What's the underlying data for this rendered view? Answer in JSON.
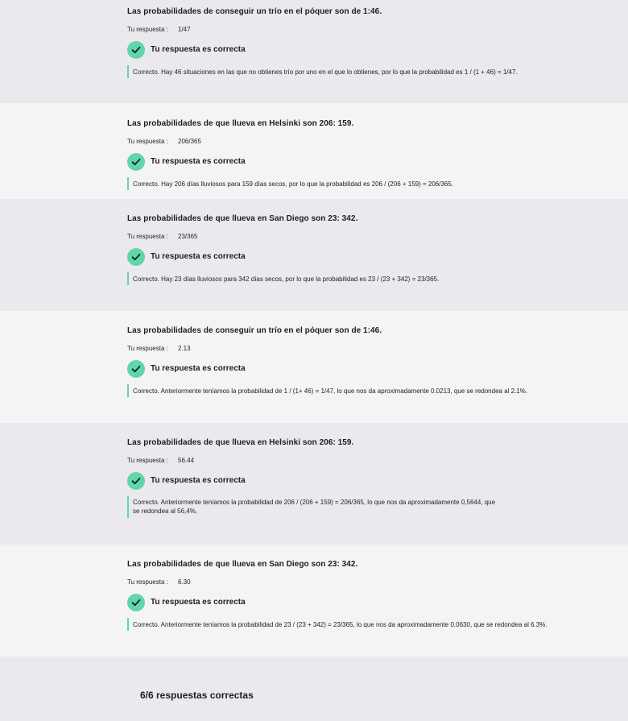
{
  "colors": {
    "accent": "#5fd6ab",
    "band_shade": "#ebe9ee",
    "band_light": "#f5f4f5"
  },
  "answer_label": "Tu respuesta :",
  "result_text": "Tu respuesta es correcta",
  "questions": [
    {
      "title": "Las probabilidades de conseguir un trío en el póquer son de 1:46.",
      "answer": "1/47",
      "explanation": "Correcto. Hay 46 situaciones en las que no obtienes trío por uno en el que lo obtienes, por lo que la probabilidad es 1 / (1 + 46) = 1/47."
    },
    {
      "title": "Las probabilidades de que llueva en Helsinki son 206: 159.",
      "answer": "206/365",
      "explanation": "Correcto. Hay 206 días lluviosos para 159 días secos, por lo que la probabilidad es 206 / (206 + 159) = 206/365."
    },
    {
      "title": "Las probabilidades de que llueva en San Diego son 23: 342.",
      "answer": "23/365",
      "explanation": "Correcto. Hay 23 días lluviosos para 342 días secos, por lo que la probabilidad es 23 / (23 + 342) = 23/365."
    },
    {
      "title": "Las probabilidades de conseguir un trío en el póquer son de 1:46.",
      "answer": "2.13",
      "explanation": "Correcto. Anteriormente teníamos la probabilidad de 1 / (1+ 46) = 1/47, lo que nos da aproximadamente 0.0213, que se redondea al 2.1%."
    },
    {
      "title": "Las probabilidades de que llueva en Helsinki son 206: 159.",
      "answer": "56.44",
      "explanation": "Correcto. Anteriormente teníamos la probabilidad de 206 / (206 + 159) = 206/365, lo que nos da aproximadamente 0,5644, que se redondea al 56,4%."
    },
    {
      "title": "Las probabilidades de que llueva en San Diego son 23: 342.",
      "answer": "6.30",
      "explanation": "Correcto. Anteriormente teníamos la probabilidad de 23 / (23 + 342) = 23/365, lo que nos da aproximadamente 0.0630, que se redondea al 6.3%."
    }
  ],
  "summary": "6/6 respuestas correctas"
}
